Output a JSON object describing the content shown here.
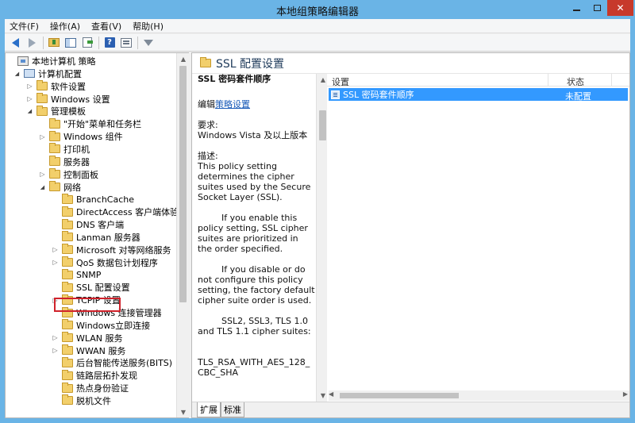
{
  "window": {
    "title": "本地组策略编辑器",
    "colors": {
      "frame": "#6ab4e6",
      "close": "#c7392b",
      "selection": "#3399ff",
      "highlight": "#d0222b"
    }
  },
  "menu": {
    "items": [
      "文件(F)",
      "操作(A)",
      "查看(V)",
      "帮助(H)"
    ]
  },
  "toolbar": {
    "icons": [
      "back-arrow-icon",
      "forward-arrow-icon",
      "folder-up-icon",
      "show-hide-tree-icon",
      "export-list-icon",
      "help-icon",
      "properties-view-icon",
      "filter-icon"
    ]
  },
  "tree": {
    "items": [
      {
        "label": "本地计算机 策略",
        "level": 0,
        "state": "none",
        "icon": "group-policy-icon"
      },
      {
        "label": "计算机配置",
        "level": 1,
        "state": "open",
        "icon": "computer-icon"
      },
      {
        "label": "软件设置",
        "level": 2,
        "state": "closed",
        "icon": "folder-icon"
      },
      {
        "label": "Windows 设置",
        "level": 2,
        "state": "closed",
        "icon": "folder-icon"
      },
      {
        "label": "管理模板",
        "level": 2,
        "state": "open",
        "icon": "folder-icon"
      },
      {
        "label": "\"开始\"菜单和任务栏",
        "level": 3,
        "state": "none",
        "icon": "folder-icon"
      },
      {
        "label": "Windows 组件",
        "level": 3,
        "state": "closed",
        "icon": "folder-icon"
      },
      {
        "label": "打印机",
        "level": 3,
        "state": "none",
        "icon": "folder-icon"
      },
      {
        "label": "服务器",
        "level": 3,
        "state": "none",
        "icon": "folder-icon"
      },
      {
        "label": "控制面板",
        "level": 3,
        "state": "closed",
        "icon": "folder-icon"
      },
      {
        "label": "网络",
        "level": 3,
        "state": "open",
        "icon": "folder-icon"
      },
      {
        "label": "BranchCache",
        "level": 4,
        "state": "none",
        "icon": "folder-icon"
      },
      {
        "label": "DirectAccess 客户端体验设置",
        "level": 4,
        "state": "none",
        "icon": "folder-icon"
      },
      {
        "label": "DNS 客户端",
        "level": 4,
        "state": "none",
        "icon": "folder-icon"
      },
      {
        "label": "Lanman 服务器",
        "level": 4,
        "state": "none",
        "icon": "folder-icon"
      },
      {
        "label": "Microsoft 对等网络服务",
        "level": 4,
        "state": "closed",
        "icon": "folder-icon"
      },
      {
        "label": "QoS 数据包计划程序",
        "level": 4,
        "state": "closed",
        "icon": "folder-icon"
      },
      {
        "label": "SNMP",
        "level": 4,
        "state": "none",
        "icon": "folder-icon"
      },
      {
        "label": "SSL 配置设置",
        "level": 4,
        "state": "none",
        "icon": "folder-icon",
        "selected": true
      },
      {
        "label": "TCPIP 设置",
        "level": 4,
        "state": "closed",
        "icon": "folder-icon"
      },
      {
        "label": "Windows 连接管理器",
        "level": 4,
        "state": "none",
        "icon": "folder-icon"
      },
      {
        "label": "Windows立即连接",
        "level": 4,
        "state": "none",
        "icon": "folder-icon"
      },
      {
        "label": "WLAN 服务",
        "level": 4,
        "state": "closed",
        "icon": "folder-icon"
      },
      {
        "label": "WWAN 服务",
        "level": 4,
        "state": "closed",
        "icon": "folder-icon"
      },
      {
        "label": "后台智能传送服务(BITS)",
        "level": 4,
        "state": "none",
        "icon": "folder-icon"
      },
      {
        "label": "链路层拓扑发现",
        "level": 4,
        "state": "none",
        "icon": "folder-icon"
      },
      {
        "label": "热点身份验证",
        "level": 4,
        "state": "none",
        "icon": "folder-icon"
      },
      {
        "label": "脱机文件",
        "level": 4,
        "state": "none",
        "icon": "folder-icon"
      }
    ]
  },
  "details": {
    "header_title": "SSL 配置设置",
    "desc_title": "SSL 密码套件顺序",
    "edit_prefix": "编辑",
    "edit_link": "策略设置",
    "requirements_label": "要求:",
    "requirements_value": "Windows Vista 及以上版本",
    "description_label": "描述:",
    "paragraphs": [
      "This policy setting determines the cipher suites used by the Secure Socket Layer (SSL).",
      "If you enable this policy setting, SSL cipher suites are prioritized in the order specified.",
      "If you disable or do not configure this policy setting, the factory default cipher suite order is used.",
      "SSL2, SSL3, TLS 1.0 and TLS 1.1 cipher suites:",
      "TLS_RSA_WITH_AES_128_CBC_SHA"
    ]
  },
  "list": {
    "col_setting": "设置",
    "col_state": "状态",
    "rows": [
      {
        "setting": "SSL 密码套件顺序",
        "state": "未配置"
      }
    ]
  },
  "tabs": [
    "扩展",
    "标准"
  ]
}
